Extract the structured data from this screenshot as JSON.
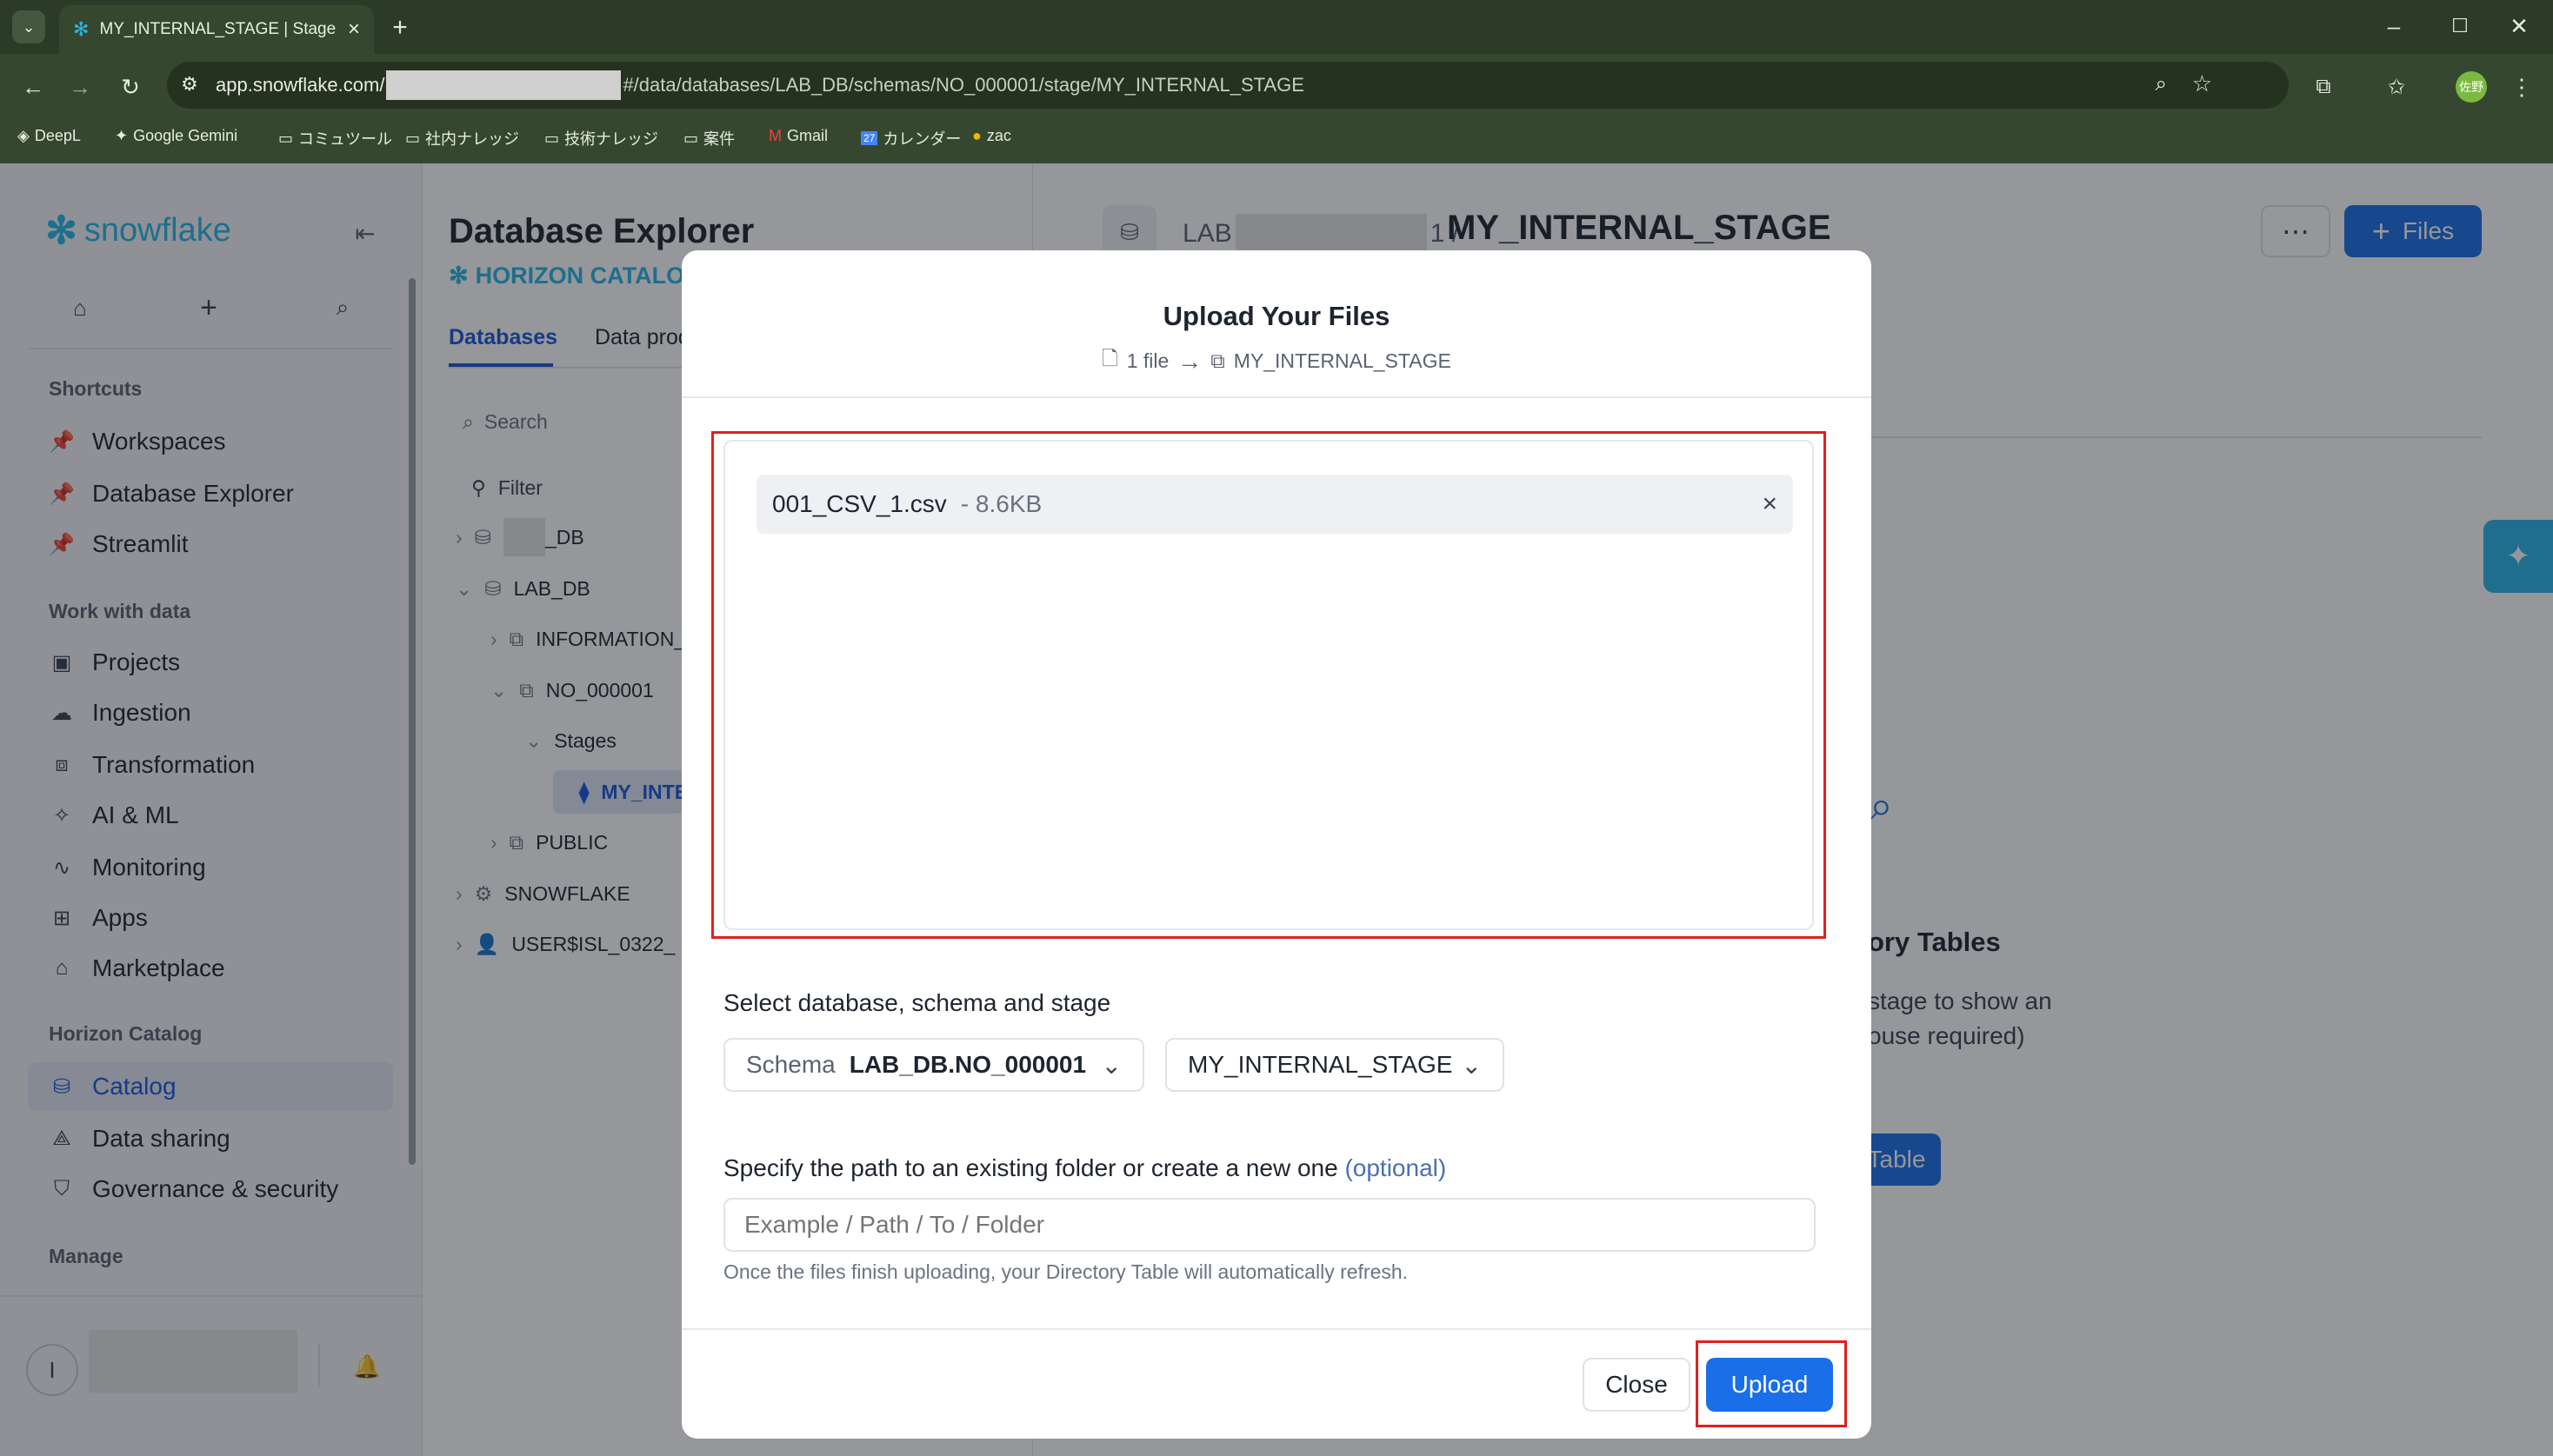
{
  "browser": {
    "tab_title": "MY_INTERNAL_STAGE | Stage",
    "url_prefix": "app.snowflake.com/",
    "url_suffix": "#/data/databases/LAB_DB/schemas/NO_000001/stage/MY_INTERNAL_STAGE",
    "bookmarks": [
      {
        "label": "DeepL",
        "icon": "deepl-icon"
      },
      {
        "label": "Google Gemini",
        "icon": "gemini-icon"
      },
      {
        "label": "コミュツール",
        "icon": "folder-icon"
      },
      {
        "label": "社内ナレッジ",
        "icon": "folder-icon"
      },
      {
        "label": "技術ナレッジ",
        "icon": "folder-icon"
      },
      {
        "label": "案件",
        "icon": "folder-icon"
      },
      {
        "label": "Gmail",
        "icon": "gmail-icon"
      },
      {
        "label": "カレンダー",
        "icon": "calendar-icon"
      },
      {
        "label": "zac",
        "icon": "zac-icon"
      }
    ],
    "avatar_label": "佐野"
  },
  "sidebar": {
    "brand": "snowflake",
    "shortcuts_heading": "Shortcuts",
    "shortcuts": [
      "Workspaces",
      "Database Explorer",
      "Streamlit"
    ],
    "work_heading": "Work with data",
    "work_items": [
      "Projects",
      "Ingestion",
      "Transformation",
      "AI & ML",
      "Monitoring",
      "Apps",
      "Marketplace"
    ],
    "horizon_heading": "Horizon Catalog",
    "horizon_items": [
      "Catalog",
      "Data sharing",
      "Governance & security"
    ],
    "manage_heading": "Manage",
    "user_initial": "I"
  },
  "explorer": {
    "title": "Database Explorer",
    "subtitle": "HORIZON CATALOG",
    "tabs": [
      "Databases",
      "Data products"
    ],
    "search_placeholder": "Search",
    "filter_label": "Filter",
    "tree": [
      {
        "label": "_DB",
        "level": 0
      },
      {
        "label": "LAB_DB",
        "level": 0
      },
      {
        "label": "INFORMATION_SCHEMA",
        "level": 1
      },
      {
        "label": "NO_000001",
        "level": 1
      },
      {
        "label": "Stages",
        "level": 2
      },
      {
        "label": "MY_INTERNAL_STAGE",
        "level": 3
      },
      {
        "label": "PUBLIC",
        "level": 1
      },
      {
        "label": "SNOWFLAKE",
        "level": 0
      },
      {
        "label": "USER$ISL_0322_",
        "level": 0
      }
    ]
  },
  "main": {
    "breadcrumb_prefix": "LAB",
    "breadcrumb_suffix": "1 /",
    "title": "MY_INTERNAL_STAGE",
    "files_button": "Files",
    "empty_title": "ory Tables",
    "empty_line1": "stage to show an",
    "empty_line2": "ouse required)",
    "empty_button": "Table"
  },
  "modal": {
    "title": "Upload Your Files",
    "subtitle_count": "1 file",
    "subtitle_dest": "MY_INTERNAL_STAGE",
    "file_name": "001_CSV_1.csv",
    "file_size": "- 8.6KB",
    "select_label": "Select database, schema and stage",
    "schema_prefix": "Schema",
    "schema_value": "LAB_DB.NO_000001",
    "stage_value": "MY_INTERNAL_STAGE",
    "path_label": "Specify the path to an existing folder or create a new one",
    "path_optional": "(optional)",
    "path_placeholder": "Example / Path / To / Folder",
    "hint": "Once the files finish uploading, your Directory Table will automatically refresh.",
    "close_button": "Close",
    "upload_button": "Upload"
  },
  "colors": {
    "accent": "#1a6ee8",
    "highlight": "#e0201f",
    "snowflake": "#29b5e8"
  }
}
